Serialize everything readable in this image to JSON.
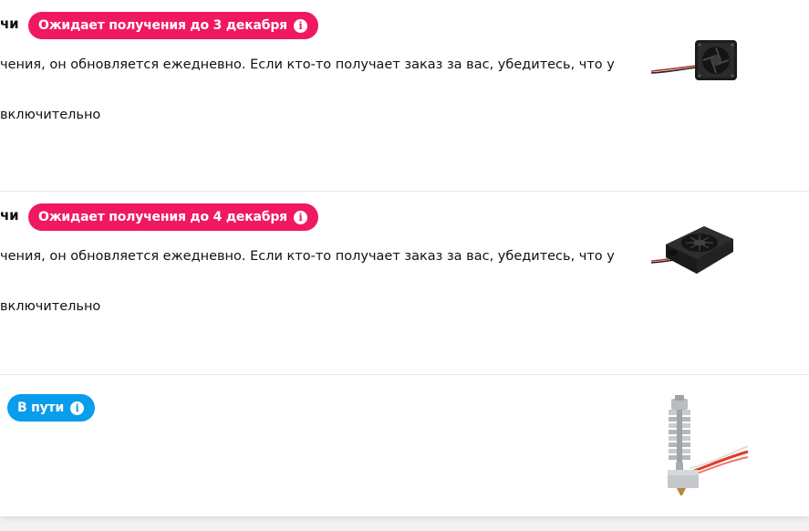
{
  "orders": [
    {
      "heading_fragment": "чи",
      "status": "Ожидает получения до 3 декабря",
      "status_color": "#f0195f",
      "description_line": "чения, он обновляется ежедневно. Если кто-то получает заказ за вас, убедитесь, что у",
      "date_line": "включительно",
      "product_icon": "mini-cooling-fan-icon"
    },
    {
      "heading_fragment": "чи",
      "status": "Ожидает получения до 4 декабря",
      "status_color": "#f0195f",
      "description_line": "чения, он обновляется ежедневно. Если кто-то получает заказ за вас, убедитесь, что у",
      "date_line": "включительно",
      "product_icon": "blower-fan-icon"
    },
    {
      "status": "В пути",
      "status_color": "#0a9ced",
      "product_icon": "hotend-heatsink-icon"
    }
  ]
}
